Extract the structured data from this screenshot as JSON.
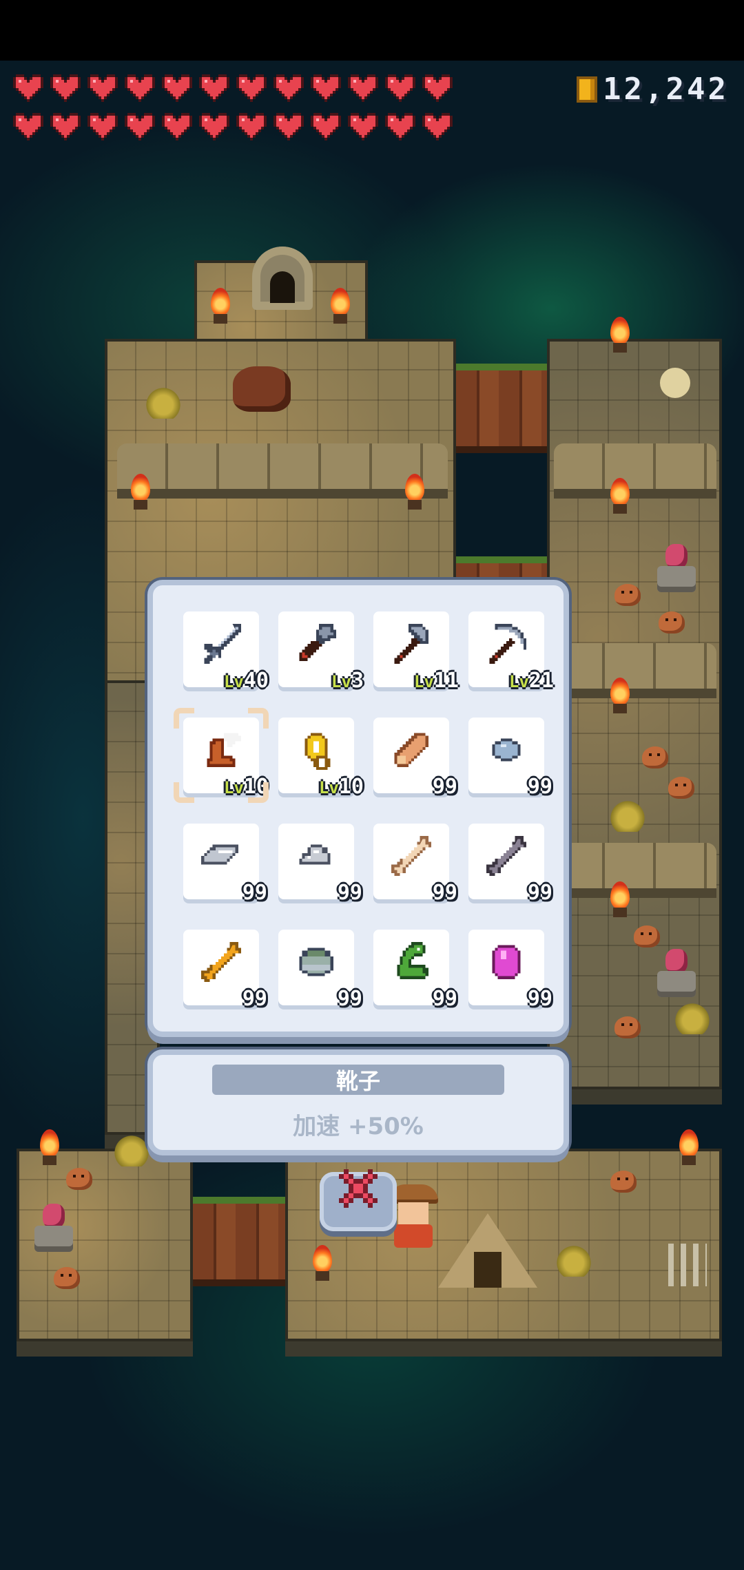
{
  "hud": {
    "hearts_rows": [
      [
        "heart",
        "heart",
        "heart",
        "heart",
        "heart",
        "heart",
        "heart",
        "heart",
        "heart",
        "heart",
        "heart",
        "heart"
      ],
      [
        "heart",
        "heart",
        "heart",
        "heart",
        "heart",
        "heart",
        "heart",
        "heart",
        "heart",
        "heart",
        "heart",
        "heart"
      ]
    ],
    "heart_color": "#e8434f",
    "coin_icon": "coin-icon",
    "coin_count": "12,242"
  },
  "inventory": {
    "slots": [
      {
        "icon": "sword-icon",
        "level_prefix": "Lv",
        "level": "40",
        "quantity": null,
        "selected": false
      },
      {
        "icon": "shovel-icon",
        "level_prefix": "Lv",
        "level": "3",
        "quantity": null,
        "selected": false
      },
      {
        "icon": "axe-icon",
        "level_prefix": "Lv",
        "level": "11",
        "quantity": null,
        "selected": false
      },
      {
        "icon": "pickaxe-icon",
        "level_prefix": "Lv",
        "level": "21",
        "quantity": null,
        "selected": false
      },
      {
        "icon": "winged-boots-icon",
        "level_prefix": "Lv",
        "level": "10",
        "quantity": null,
        "selected": true
      },
      {
        "icon": "gold-ring-icon",
        "level_prefix": "Lv",
        "level": "10",
        "quantity": null,
        "selected": false
      },
      {
        "icon": "wood-log-icon",
        "level_prefix": null,
        "level": null,
        "quantity": "99",
        "selected": false
      },
      {
        "icon": "stone-icon",
        "level_prefix": null,
        "level": null,
        "quantity": "99",
        "selected": false
      },
      {
        "icon": "iron-ingot-icon",
        "level_prefix": null,
        "level": null,
        "quantity": "99",
        "selected": false
      },
      {
        "icon": "iron-ore-icon",
        "level_prefix": null,
        "level": null,
        "quantity": "99",
        "selected": false
      },
      {
        "icon": "bone-icon",
        "level_prefix": null,
        "level": null,
        "quantity": "99",
        "selected": false
      },
      {
        "icon": "dark-bone-icon",
        "level_prefix": null,
        "level": null,
        "quantity": "99",
        "selected": false
      },
      {
        "icon": "golden-bone-icon",
        "level_prefix": null,
        "level": null,
        "quantity": "99",
        "selected": false
      },
      {
        "icon": "mossy-rock-icon",
        "level_prefix": null,
        "level": null,
        "quantity": "99",
        "selected": false
      },
      {
        "icon": "green-snake-icon",
        "level_prefix": null,
        "level": null,
        "quantity": "99",
        "selected": false
      },
      {
        "icon": "pink-gem-icon",
        "level_prefix": null,
        "level": null,
        "quantity": "99",
        "selected": false
      }
    ]
  },
  "selected_item": {
    "name": "靴子",
    "effect": "加速 +50%"
  },
  "close_button": {
    "icon": "close-icon",
    "color": "#e8435c"
  }
}
